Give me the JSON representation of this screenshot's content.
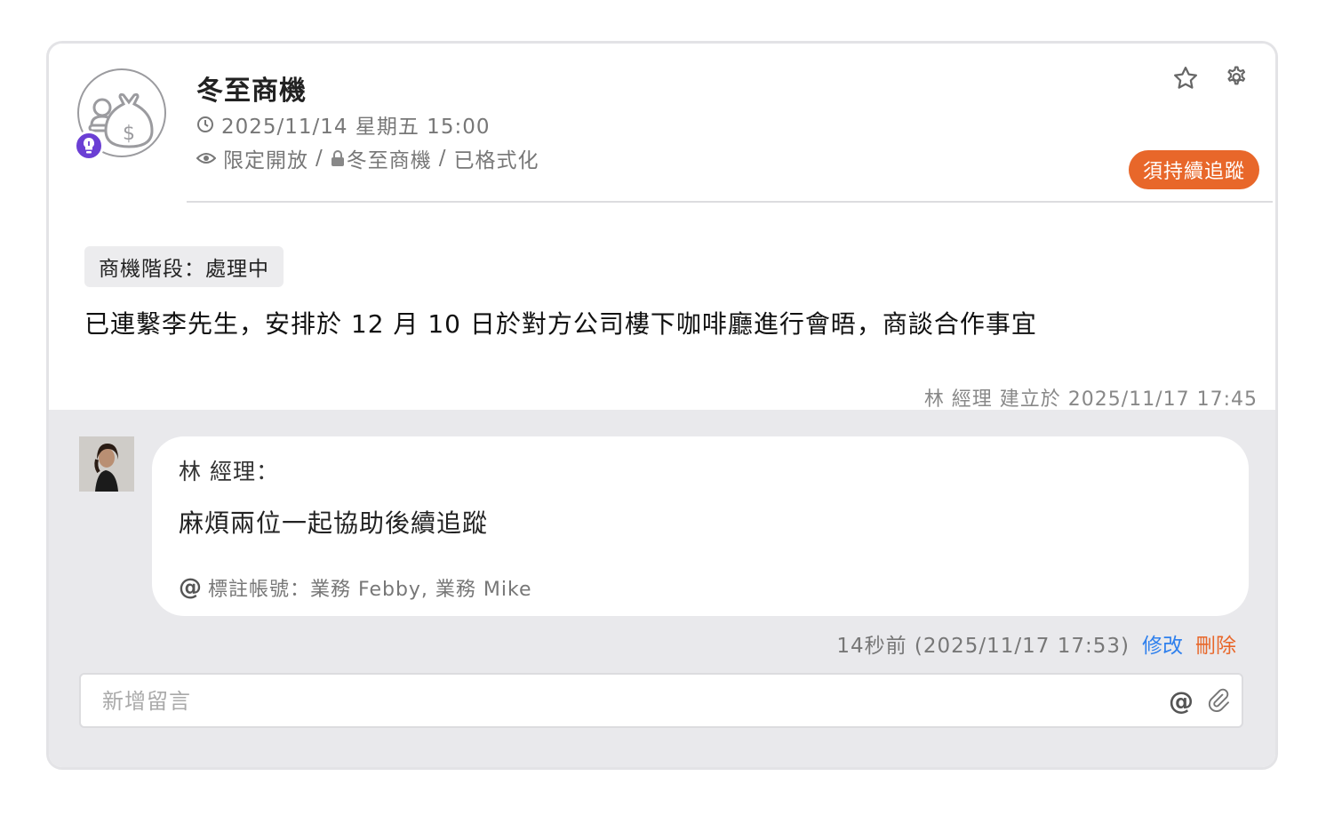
{
  "post": {
    "title": "冬至商機",
    "datetime": "2025/11/14 星期五 15:00",
    "visibility": "限定開放",
    "channel": "冬至商機",
    "format": "已格式化",
    "status_tag": "須持續追蹤",
    "stage_label": "商機階段：處理中",
    "content": "已連繫李先生，安排於 12 月 10 日於對方公司樓下咖啡廳進行會晤，商談合作事宜",
    "creator_line": "林 經理 建立於 2025/11/17 17:45",
    "icons": {
      "avatar": "money-bag-icon",
      "badge": "lightbulb-icon",
      "clock": "clock-icon",
      "eye": "eye-icon",
      "lock": "lock-icon",
      "star": "star-icon",
      "settings": "gear-icon"
    }
  },
  "comment": {
    "author": "林 經理：",
    "text": "麻煩兩位一起協助後續追蹤",
    "mention_label": "標註帳號：業務 Febby, 業務 Mike",
    "time": "14秒前 (2025/11/17 17:53)",
    "edit_label": "修改",
    "delete_label": "刪除"
  },
  "new_comment": {
    "placeholder": "新增留言",
    "value": "",
    "icons": [
      "at-icon",
      "paperclip-icon"
    ]
  },
  "colors": {
    "accent_orange": "#e8672a",
    "link_blue": "#2f80ed",
    "badge_purple": "#6b3fd4",
    "comment_bg": "#e9e9ec"
  }
}
